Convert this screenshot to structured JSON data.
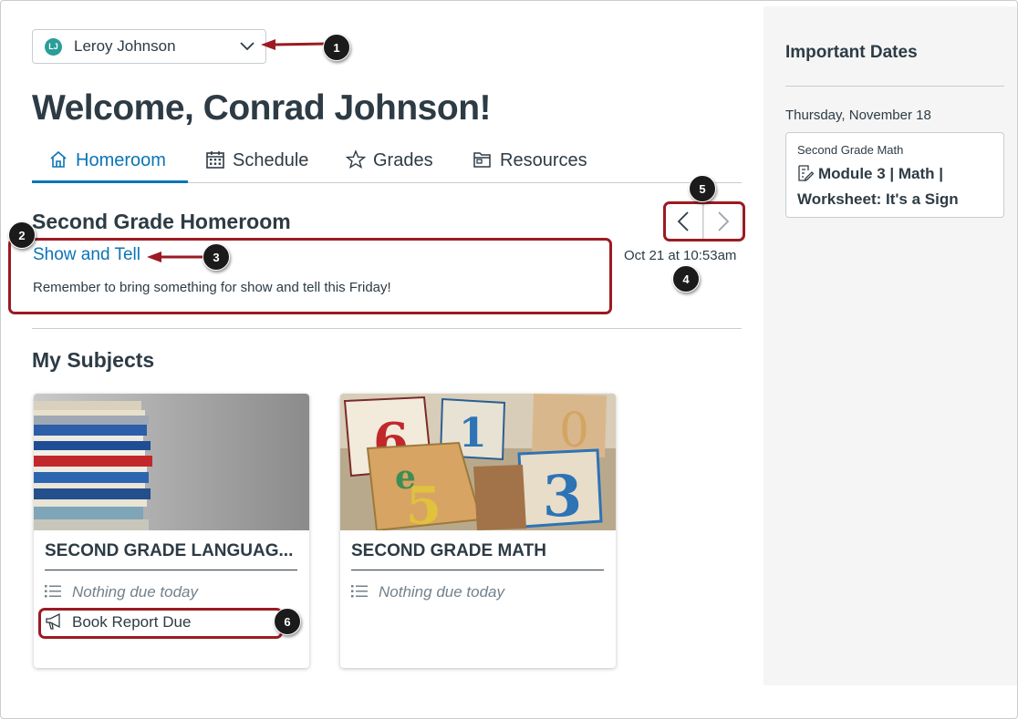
{
  "student_select": {
    "initials": "LJ",
    "name": "Leroy Johnson"
  },
  "welcome": "Welcome, Conrad Johnson!",
  "tabs": [
    {
      "label": "Homeroom",
      "icon": "home-icon",
      "active": true
    },
    {
      "label": "Schedule",
      "icon": "calendar-icon",
      "active": false
    },
    {
      "label": "Grades",
      "icon": "star-icon",
      "active": false
    },
    {
      "label": "Resources",
      "icon": "folder-icon",
      "active": false
    }
  ],
  "homeroom": {
    "title": "Second Grade Homeroom",
    "announcement_title": "Show and Tell",
    "announcement_body": "Remember to bring something for show and tell this Friday!",
    "posted_at": "Oct 21 at 10:53am"
  },
  "subjects": {
    "title": "My Subjects",
    "cards": [
      {
        "name": "SECOND GRADE LANGUAG...",
        "due": "Nothing due today",
        "announcement": "Book Report Due",
        "image": "stack-of-books"
      },
      {
        "name": "SECOND GRADE MATH",
        "due": "Nothing due today",
        "announcement": "",
        "image": "alphabet-number-blocks"
      }
    ]
  },
  "important_dates": {
    "title": "Important Dates",
    "date": "Thursday, November 18",
    "item_course": "Second Grade Math",
    "item_title": "Module 3 | Math | Worksheet: It's a Sign",
    "item_icon": "assignment-icon"
  },
  "callouts": [
    "1",
    "2",
    "3",
    "4",
    "5",
    "6"
  ],
  "colors": {
    "link": "#0b74b6",
    "callout": "#9b1b22",
    "avatar": "#2a9d98",
    "text": "#2d3b45",
    "muted": "#73818c"
  }
}
